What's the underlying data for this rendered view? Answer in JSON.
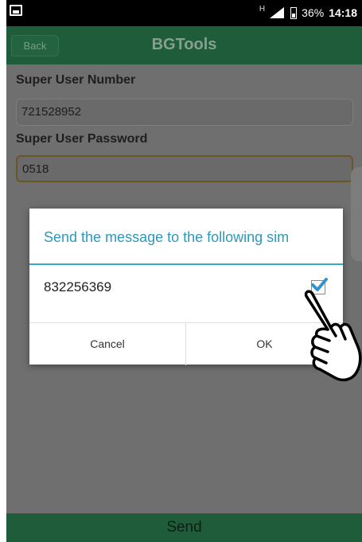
{
  "status_bar": {
    "network_indicator": "H",
    "battery": "36%",
    "time": "14:18"
  },
  "header": {
    "back_label": "Back",
    "title": "BGTools"
  },
  "form": {
    "super_user_number_label": "Super User Number",
    "super_user_number_value": "721528952",
    "super_user_password_label": "Super User Password",
    "super_user_password_value": "0518"
  },
  "dialog": {
    "title": "Send the message to the following sim",
    "sim_number": "832256369",
    "checked": true,
    "cancel_label": "Cancel",
    "ok_label": "OK"
  },
  "footer": {
    "send_label": "Send"
  },
  "colors": {
    "accent": "#35a8cc",
    "header": "#1f5c39",
    "dim_background": "#6f6f6f"
  },
  "icons": [
    "image-icon",
    "signal-icon",
    "battery-icon",
    "checkmark-icon",
    "pointing-hand-icon"
  ]
}
